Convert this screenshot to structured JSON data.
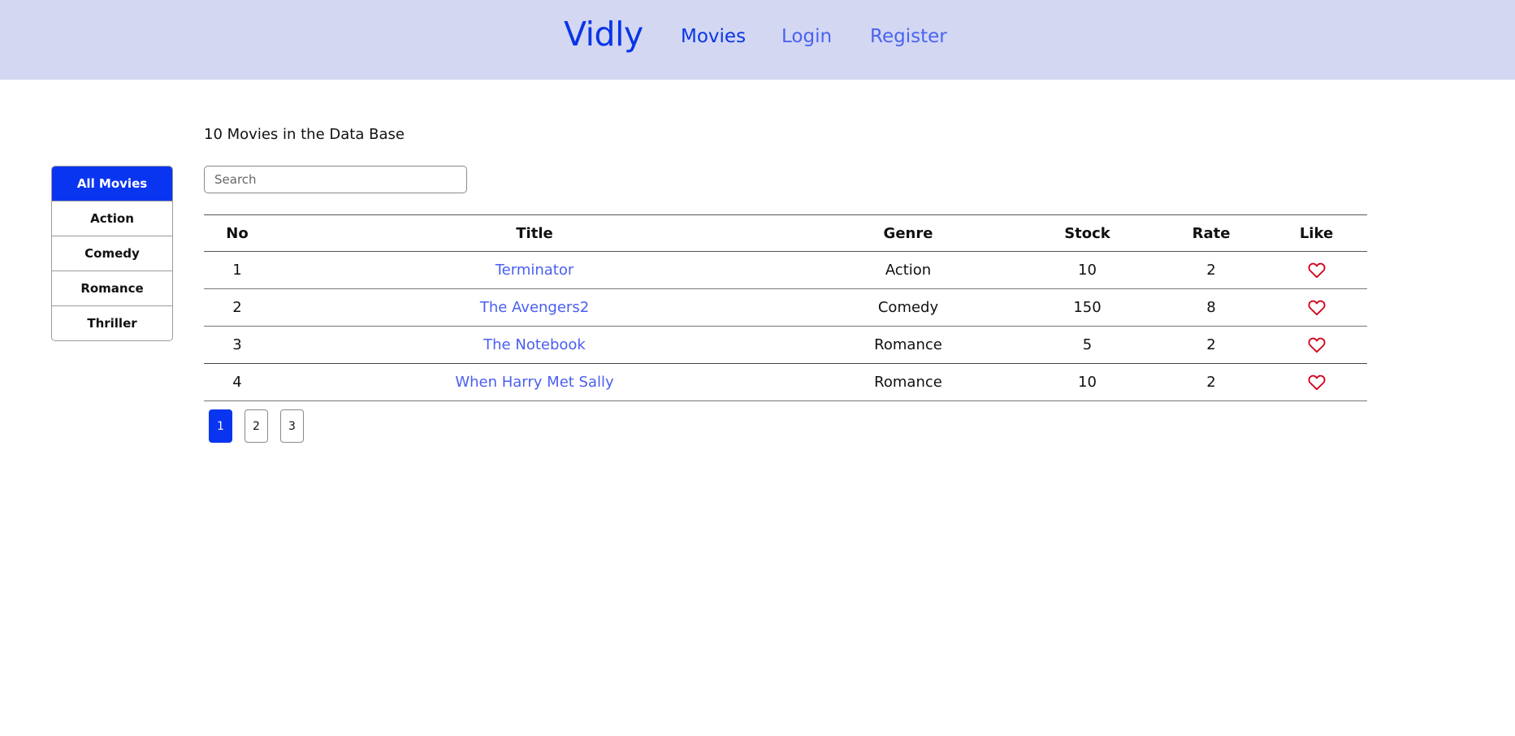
{
  "nav": {
    "brand": "Vidly",
    "links": [
      {
        "label": "Movies",
        "active": true
      },
      {
        "label": "Login",
        "active": false
      },
      {
        "label": "Register",
        "active": false
      }
    ]
  },
  "sidebar": {
    "items": [
      {
        "label": "All Movies",
        "active": true
      },
      {
        "label": "Action",
        "active": false
      },
      {
        "label": "Comedy",
        "active": false
      },
      {
        "label": "Romance",
        "active": false
      },
      {
        "label": "Thriller",
        "active": false
      }
    ]
  },
  "main": {
    "count_text": "10 Movies in the Data Base",
    "search": {
      "placeholder": "Search",
      "value": ""
    },
    "table": {
      "headers": [
        "No",
        "Title",
        "Genre",
        "Stock",
        "Rate",
        "Like"
      ],
      "rows": [
        {
          "no": "1",
          "title": "Terminator",
          "genre": "Action",
          "stock": "10",
          "rate": "2",
          "like_icon": "heart-outline-icon"
        },
        {
          "no": "2",
          "title": "The Avengers2",
          "genre": "Comedy",
          "stock": "150",
          "rate": "8",
          "like_icon": "heart-outline-icon"
        },
        {
          "no": "3",
          "title": "The Notebook",
          "genre": "Romance",
          "stock": "5",
          "rate": "2",
          "like_icon": "heart-outline-icon"
        },
        {
          "no": "4",
          "title": "When Harry Met Sally",
          "genre": "Romance",
          "stock": "10",
          "rate": "2",
          "like_icon": "heart-outline-icon"
        }
      ]
    },
    "pagination": {
      "pages": [
        "1",
        "2",
        "3"
      ],
      "current": "1"
    }
  },
  "colors": {
    "navbar_bg": "#d3d7f2",
    "brand": "#0a35e6",
    "active_item": "#0a35f0",
    "link": "#4a5ff0",
    "heart": "#d0021b"
  }
}
